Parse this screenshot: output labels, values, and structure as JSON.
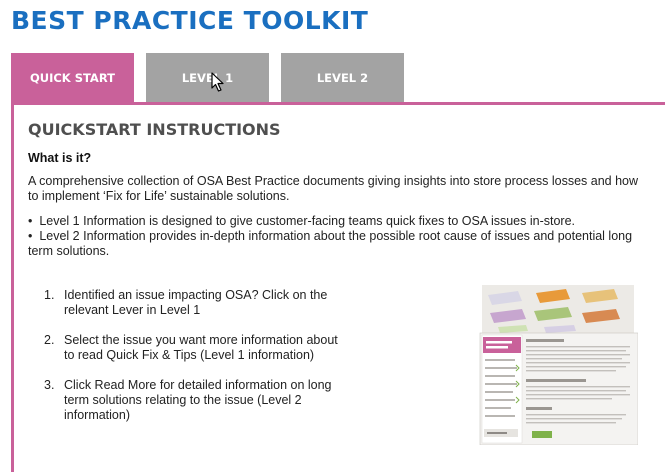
{
  "header": {
    "title": "BEST PRACTICE TOOLKIT"
  },
  "tabs": [
    {
      "label": "QUICK START"
    },
    {
      "label": "LEVEL 1"
    },
    {
      "label": "LEVEL 2"
    }
  ],
  "content": {
    "title": "QUICKSTART INSTRUCTIONS",
    "what_heading": "What is it?",
    "intro": "A comprehensive collection of OSA Best Practice documents giving insights into store process losses and how to implement ‘Fix for Life’ sustainable solutions.",
    "bullets": [
      "Level 1 Information is designed to give customer-facing teams quick fixes to OSA issues in-store.",
      "Level 2 Information provides in-depth information about the possible root cause of issues and potential long term solutions."
    ],
    "steps": [
      {
        "num": "1.",
        "text": "Identified an issue impacting OSA? Click on the relevant Lever in Level 1"
      },
      {
        "num": "2.",
        "text": "Select the issue you want more information about to read Quick Fix & Tips (Level 1 information)"
      },
      {
        "num": "3.",
        "text": "Click Read More for detailed information on long term solutions relating to the issue (Level 2 information)"
      }
    ]
  },
  "colors": {
    "accent": "#c9619a",
    "title_blue": "#1a6fc0",
    "tab_inactive": "#a3a3a3"
  }
}
